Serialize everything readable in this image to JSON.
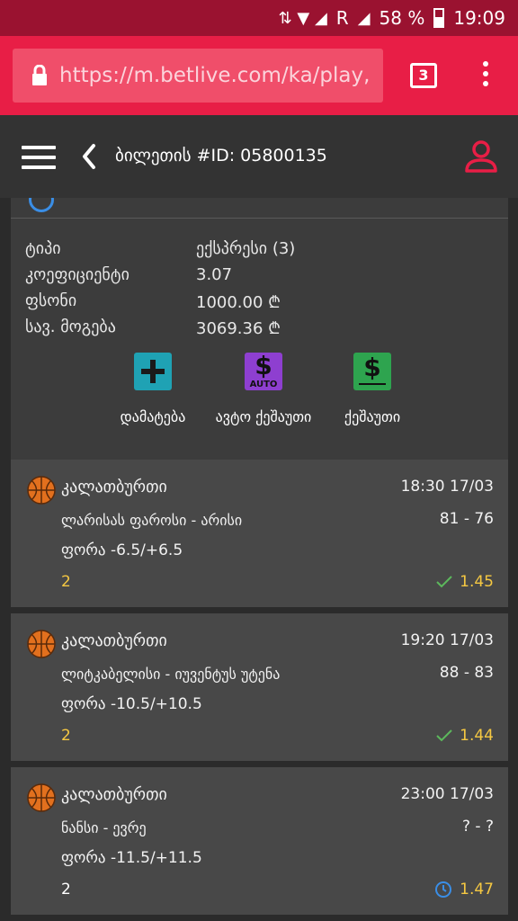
{
  "status_bar": {
    "battery": "58 %",
    "time": "19:09",
    "network": "R"
  },
  "browser": {
    "url": "https://m.betlive.com/ka/play,",
    "tab_count": "3"
  },
  "header": {
    "title": "ბილეთის #ID: 05800135"
  },
  "ticket": {
    "rows": [
      {
        "label": "ტიპი",
        "value": "ექსპრესი (3)"
      },
      {
        "label": "კოეფიციენტი",
        "value": "3.07"
      },
      {
        "label": "ფსონი",
        "value": "1000.00 ₾"
      },
      {
        "label": "სავ. მოგება",
        "value": "3069.36 ₾"
      }
    ],
    "actions": [
      {
        "label": "დამატება",
        "icon": "plus-icon",
        "color": "#1fa2b4"
      },
      {
        "label": "ავტო ქეშაუთი",
        "icon": "dollar-auto-icon",
        "color": "#8e3fd0",
        "badge": "AUTO"
      },
      {
        "label": "ქეშაუთი",
        "icon": "dollar-icon",
        "color": "#2ea44f"
      }
    ]
  },
  "bets": [
    {
      "sport": "კალათბურთი",
      "datetime": "18:30 17/03",
      "teams": "ლარისას ფაროსი - არისი",
      "score": "81 - 76",
      "market": "ფორა -6.5/+6.5",
      "pick": "2",
      "odds": "1.45",
      "status": "won"
    },
    {
      "sport": "კალათბურთი",
      "datetime": "19:20 17/03",
      "teams": "ლიტკაბელისი - იუვენტუს უტენა",
      "score": "88 - 83",
      "market": "ფორა -10.5/+10.5",
      "pick": "2",
      "odds": "1.44",
      "status": "won"
    },
    {
      "sport": "კალათბურთი",
      "datetime": "23:00 17/03",
      "teams": "ნანსი - ევრე",
      "score": "? - ?",
      "market": "ფორა -11.5/+11.5",
      "pick": "2",
      "odds": "1.47",
      "status": "pending"
    }
  ],
  "colors": {
    "accent": "#e81e46",
    "won": "#5cb85c",
    "pending": "#3a8ee6",
    "odds": "#f5c842",
    "pick_won": "#f5c842",
    "pick_pending": "#ffffff"
  }
}
